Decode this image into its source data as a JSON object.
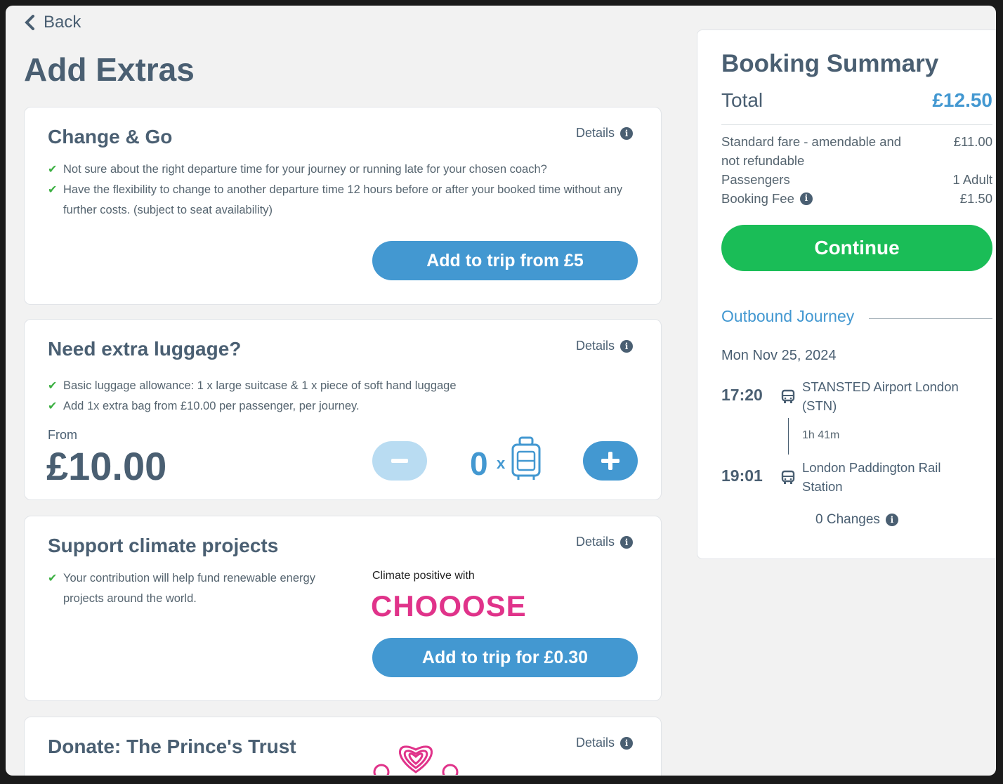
{
  "nav": {
    "back_label": "Back"
  },
  "page": {
    "title": "Add Extras"
  },
  "extras": {
    "change_go": {
      "title": "Change & Go",
      "details_label": "Details",
      "bullets": [
        "Not sure about the right departure time for your journey or running late for your chosen coach?",
        "Have the flexibility to change to another departure time 12 hours before or after your booked time without any further costs. (subject to seat availability)"
      ],
      "button_label": "Add to trip from £5"
    },
    "luggage": {
      "title": "Need extra luggage?",
      "details_label": "Details",
      "bullets": [
        "Basic luggage allowance: 1 x large suitcase & 1 x piece of soft hand luggage",
        "Add 1x extra bag from £10.00 per passenger, per journey."
      ],
      "from_label": "From",
      "price": "£10.00",
      "quantity": "0",
      "multiplier": "x"
    },
    "climate": {
      "title": "Support climate projects",
      "details_label": "Details",
      "bullets": [
        "Your contribution will help fund renewable energy projects around the world."
      ],
      "partner_caption": "Climate positive with",
      "partner_logo_text": "CHOOOSE",
      "button_label": "Add to trip for £0.30"
    },
    "donate": {
      "title": "Donate: The Prince's Trust",
      "details_label": "Details"
    }
  },
  "summary": {
    "title": "Booking Summary",
    "total_label": "Total",
    "total_value": "£12.50",
    "fare_label": "Standard fare - amendable and not refundable",
    "fare_value": "£11.00",
    "passengers_label": "Passengers",
    "passengers_value": "1 Adult",
    "booking_fee_label": "Booking Fee",
    "booking_fee_value": "£1.50",
    "continue_label": "Continue",
    "outbound_label": "Outbound Journey",
    "date": "Mon Nov 25, 2024",
    "departure_time": "17:20",
    "departure_station": "STANSTED Airport London (STN)",
    "duration": "1h 41m",
    "arrival_time": "19:01",
    "arrival_station": "London Paddington Rail Station",
    "changes_label": "0 Changes"
  },
  "colors": {
    "accent_blue": "#4398d1",
    "continue_green": "#1abd57",
    "text_dark": "#4a5f72",
    "check_green": "#3cb043",
    "chooose_pink": "#e0338a"
  }
}
